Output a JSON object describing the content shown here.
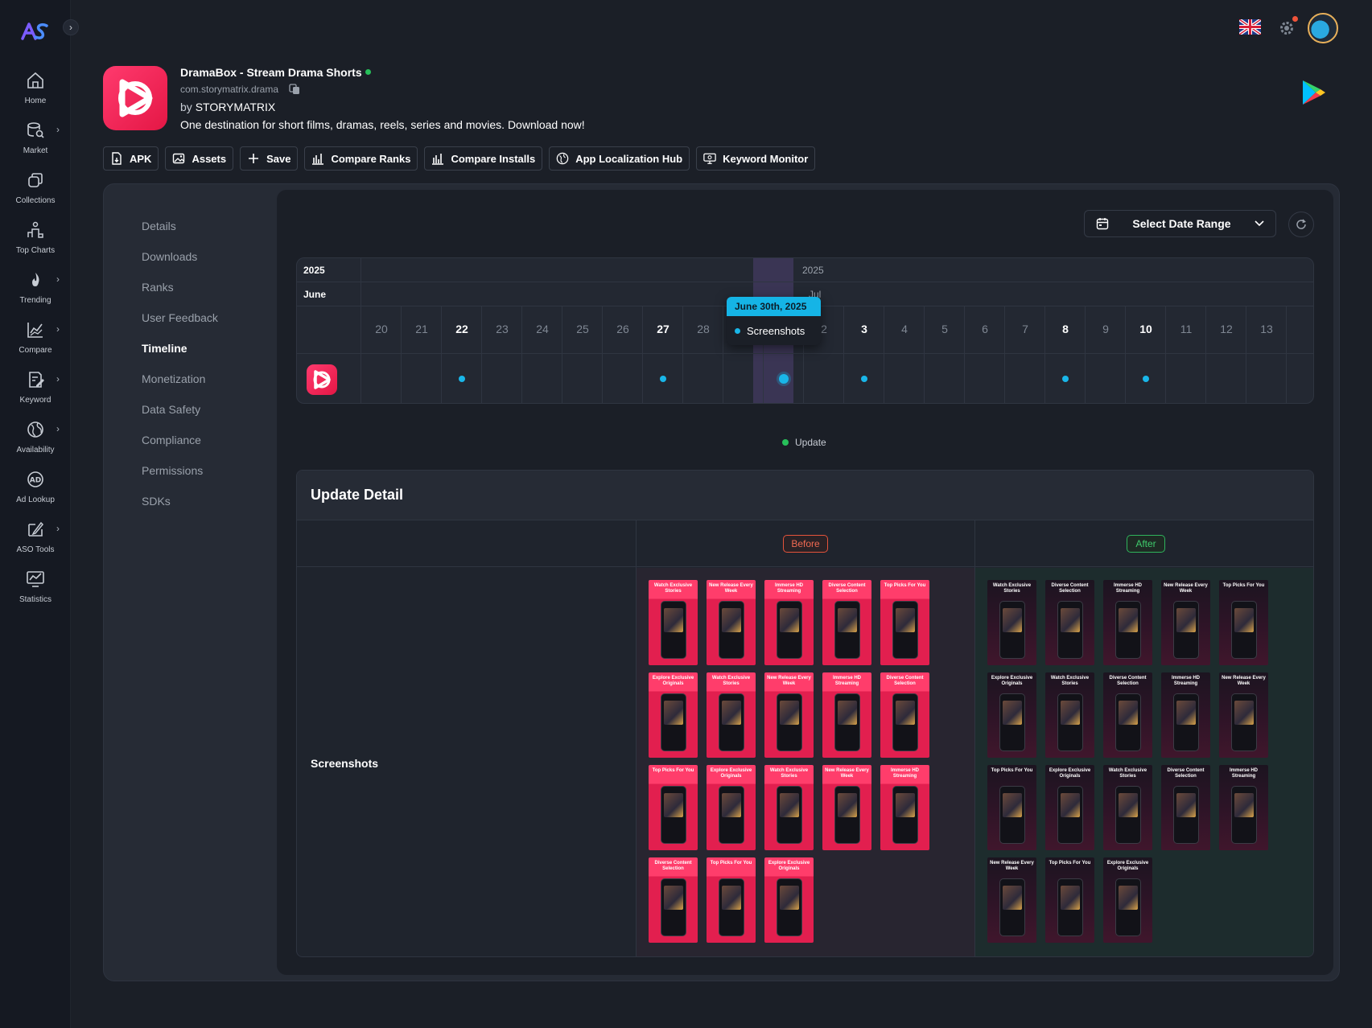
{
  "rail": {
    "logo_text": "AS",
    "items": [
      {
        "label": "Home",
        "icon": "home-icon",
        "chevron": false
      },
      {
        "label": "Market",
        "icon": "market-icon",
        "chevron": true
      },
      {
        "label": "Collections",
        "icon": "collections-icon",
        "chevron": false
      },
      {
        "label": "Top Charts",
        "icon": "top-charts-icon",
        "chevron": false
      },
      {
        "label": "Trending",
        "icon": "trending-icon",
        "chevron": true
      },
      {
        "label": "Compare",
        "icon": "compare-icon",
        "chevron": true
      },
      {
        "label": "Keyword",
        "icon": "keyword-icon",
        "chevron": true
      },
      {
        "label": "Availability",
        "icon": "globe-icon",
        "chevron": true
      },
      {
        "label": "Ad Lookup",
        "icon": "ad-icon",
        "chevron": false
      },
      {
        "label": "ASO Tools",
        "icon": "aso-tools-icon",
        "chevron": true
      },
      {
        "label": "Statistics",
        "icon": "statistics-icon",
        "chevron": false
      }
    ]
  },
  "app": {
    "title": "DramaBox - Stream Drama Shorts",
    "package": "com.storymatrix.drama",
    "by": "by",
    "developer": "STORYMATRIX",
    "description": "One destination for short films, dramas, reels, series and movies. Download now!"
  },
  "actions": [
    "APK",
    "Assets",
    "Save",
    "Compare Ranks",
    "Compare Installs",
    "App Localization Hub",
    "Keyword Monitor"
  ],
  "subnav": {
    "items": [
      "Details",
      "Downloads",
      "Ranks",
      "User Feedback",
      "Timeline",
      "Monetization",
      "Data Safety",
      "Compliance",
      "Permissions",
      "SDKs"
    ],
    "active": "Timeline"
  },
  "date_range": {
    "label": "Select Date Range"
  },
  "timeline": {
    "year_left": "2025",
    "month_left": "June",
    "year_right": "2025",
    "month_right": "Jul",
    "days": [
      "20",
      "21",
      "22",
      "23",
      "24",
      "25",
      "26",
      "27",
      "28",
      "",
      "",
      "2",
      "3",
      "4",
      "5",
      "6",
      "7",
      "8",
      "9",
      "10",
      "11",
      "12",
      "13"
    ],
    "bold_days": [
      "22",
      "27",
      "3",
      "8",
      "10"
    ],
    "event_days": [
      "22",
      "27",
      "30",
      "3",
      "8",
      "10"
    ],
    "selected_day": "30",
    "tooltip": {
      "date": "June 30th, 2025",
      "item": "Screenshots"
    },
    "legend": "Update",
    "colors": {
      "event": "#19b6e8",
      "legend": "#27c05a",
      "selected": "#3a3554"
    }
  },
  "update_detail": {
    "title": "Update Detail",
    "before_label": "Before",
    "after_label": "After",
    "row_label": "Screenshots",
    "before_captions": [
      "Watch Exclusive Stories",
      "New Release Every Week",
      "Immerse HD Streaming",
      "Diverse Content Selection",
      "Top Picks For You",
      "Explore Exclusive Originals",
      "Watch Exclusive Stories",
      "New Release Every Week",
      "Immerse HD Streaming",
      "Diverse Content Selection",
      "Top Picks For You",
      "Explore Exclusive Originals",
      "Watch Exclusive Stories",
      "New Release Every Week",
      "Immerse HD Streaming",
      "Diverse Content Selection",
      "Top Picks For You",
      "Explore Exclusive Originals"
    ],
    "after_captions": [
      "Watch Exclusive Stories",
      "Diverse Content Selection",
      "Immerse HD Streaming",
      "New Release Every Week",
      "Top Picks For You",
      "Explore Exclusive Originals",
      "Watch Exclusive Stories",
      "Diverse Content Selection",
      "Immerse HD Streaming",
      "New Release Every Week",
      "Top Picks For You",
      "Explore Exclusive Originals",
      "Watch Exclusive Stories",
      "Diverse Content Selection",
      "Immerse HD Streaming",
      "New Release Every Week",
      "Top Picks For You",
      "Explore Exclusive Originals"
    ]
  }
}
